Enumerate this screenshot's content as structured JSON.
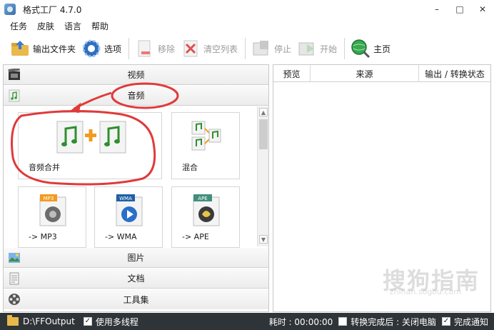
{
  "window": {
    "title": "格式工厂 4.7.0",
    "controls": [
      "–",
      "□",
      "✕"
    ]
  },
  "menu": [
    "任务",
    "皮肤",
    "语言",
    "帮助"
  ],
  "toolbar": {
    "output_folder": "输出文件夹",
    "options": "选项",
    "remove": "移除",
    "clear_list": "清空列表",
    "stop": "停止",
    "start": "开始",
    "home": "主页"
  },
  "categories": {
    "video": "视频",
    "audio": "音频",
    "picture": "图片",
    "document": "文档",
    "tools": "工具集"
  },
  "tiles": {
    "audio_join": "音频合并",
    "mix": "混合",
    "mp3": "-> MP3",
    "wma": "-> WMA",
    "ape": "-> APE",
    "mp3_badge": "MP3",
    "wma_badge": "WMA",
    "ape_badge": "APE"
  },
  "task_list": {
    "columns": [
      "预览",
      "来源",
      "输出 / 转换状态"
    ]
  },
  "status": {
    "output_path": "D:\\FFOutput",
    "multithread_label": "使用多线程",
    "multithread_checked": true,
    "elapsed": "耗时 : 00:00:00",
    "after_convert_label": "转换完成后 : 关闭电脑",
    "after_convert_checked": false,
    "notify_label": "完成通知",
    "notify_checked": true
  },
  "watermark": {
    "text": "搜狗指南",
    "sub": "zhinan.sogou.com"
  },
  "colors": {
    "annotation_red": "#e03a3a",
    "status_bg": "#2f3438",
    "accent_orange": "#f29a1f"
  }
}
